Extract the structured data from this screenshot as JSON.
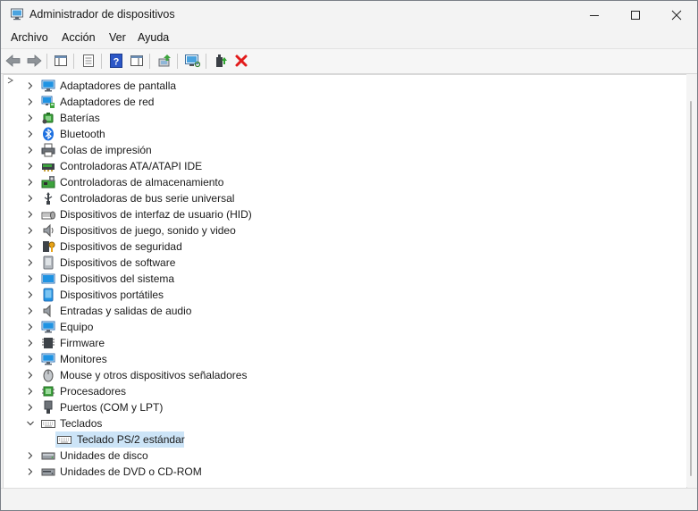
{
  "window": {
    "title": "Administrador de dispositivos"
  },
  "menu": [
    "Archivo",
    "Acción",
    "Ver",
    "Ayuda"
  ],
  "tree": [
    {
      "label": "Adaptadores de pantalla",
      "icon": "monitor-icon"
    },
    {
      "label": "Adaptadores de red",
      "icon": "network-icon"
    },
    {
      "label": "Baterías",
      "icon": "battery-icon"
    },
    {
      "label": "Bluetooth",
      "icon": "bluetooth-icon"
    },
    {
      "label": "Colas de impresión",
      "icon": "printer-icon"
    },
    {
      "label": "Controladoras ATA/ATAPI IDE",
      "icon": "ide-controller-icon"
    },
    {
      "label": "Controladoras de almacenamiento",
      "icon": "storage-controller-icon"
    },
    {
      "label": "Controladoras de bus serie universal",
      "icon": "usb-icon"
    },
    {
      "label": "Dispositivos de interfaz de usuario (HID)",
      "icon": "hid-icon"
    },
    {
      "label": "Dispositivos de juego, sonido y video",
      "icon": "speaker-icon"
    },
    {
      "label": "Dispositivos de seguridad",
      "icon": "security-key-icon"
    },
    {
      "label": "Dispositivos de software",
      "icon": "software-device-icon"
    },
    {
      "label": "Dispositivos del sistema",
      "icon": "system-device-icon"
    },
    {
      "label": "Dispositivos portátiles",
      "icon": "portable-device-icon"
    },
    {
      "label": "Entradas y salidas de audio",
      "icon": "audio-io-icon"
    },
    {
      "label": "Equipo",
      "icon": "computer-icon"
    },
    {
      "label": "Firmware",
      "icon": "firmware-icon"
    },
    {
      "label": "Monitores",
      "icon": "monitor-icon"
    },
    {
      "label": "Mouse y otros dispositivos señaladores",
      "icon": "mouse-icon"
    },
    {
      "label": "Procesadores",
      "icon": "processor-icon"
    },
    {
      "label": "Puertos (COM y LPT)",
      "icon": "port-icon"
    },
    {
      "label": "Teclados",
      "icon": "keyboard-icon",
      "expanded": true
    },
    {
      "label": "Teclado PS/2 estándar",
      "icon": "keyboard-icon",
      "child": true,
      "selected": true
    },
    {
      "label": "Unidades de disco",
      "icon": "disk-drive-icon"
    },
    {
      "label": "Unidades de DVD o CD-ROM",
      "icon": "dvd-drive-icon"
    }
  ]
}
